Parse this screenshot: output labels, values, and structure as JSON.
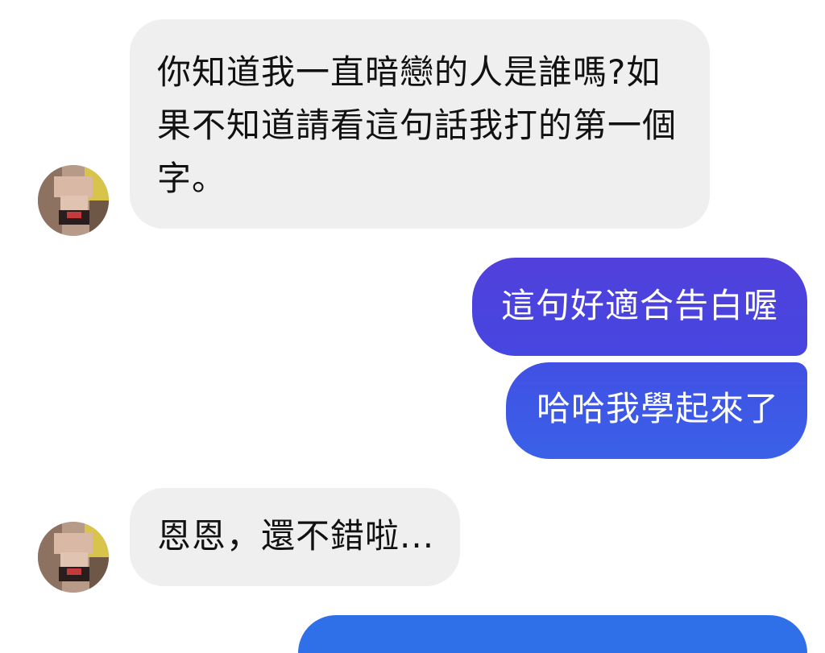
{
  "conversation": {
    "messages": [
      {
        "sender": "them",
        "text": "你知道我一直暗戀的人是誰嗎?如\n果不知道請看這句話我打的第一個\n字。"
      },
      {
        "sender": "me",
        "text": "這句好適合告白喔"
      },
      {
        "sender": "me",
        "text": "哈哈我學起來了"
      },
      {
        "sender": "them",
        "text": "恩恩，還不錯啦..."
      },
      {
        "sender": "me",
        "text": ""
      }
    ]
  },
  "colors": {
    "incoming_bubble": "#efefef",
    "incoming_text": "#111111",
    "outgoing_gradient_top": "#4c3fdc",
    "outgoing_gradient_mid": "#3b57e8",
    "outgoing_gradient_bottom": "#2f6ce8",
    "background": "#ffffff"
  },
  "icons": {
    "avatar": "pixelated-profile-avatar"
  }
}
